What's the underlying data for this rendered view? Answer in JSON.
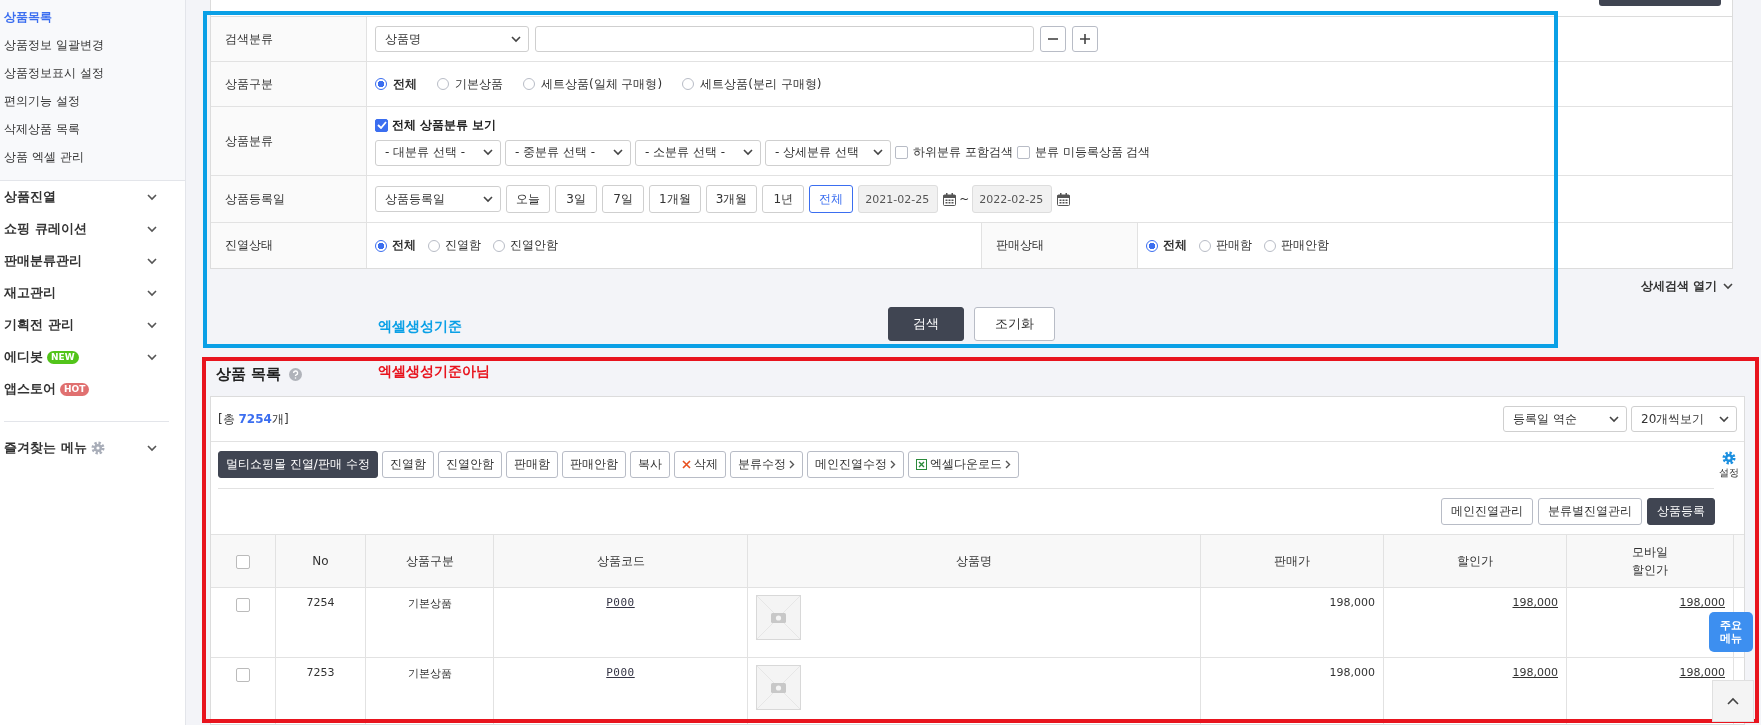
{
  "sidebar": {
    "sub_items": [
      {
        "label": "상품목록",
        "selected": true
      },
      {
        "label": "상품정보 일괄변경",
        "selected": false
      },
      {
        "label": "상품정보표시 설정",
        "selected": false
      },
      {
        "label": "편의기능 설정",
        "selected": false
      },
      {
        "label": "삭제상품 목록",
        "selected": false
      },
      {
        "label": "상품 엑셀 관리",
        "selected": false
      }
    ],
    "menus": [
      {
        "label": "상품진열",
        "expandable": true
      },
      {
        "label": "쇼핑 큐레이션",
        "expandable": true
      },
      {
        "label": "판매분류관리",
        "expandable": true
      },
      {
        "label": "재고관리",
        "expandable": true
      },
      {
        "label": "기획전 관리",
        "expandable": true
      },
      {
        "label": "에디봇",
        "expandable": true,
        "badge": {
          "text": "NEW",
          "color": "#52c41a"
        }
      },
      {
        "label": "앱스토어",
        "expandable": false,
        "badge": {
          "text": "HOT",
          "color": "#e07070"
        }
      }
    ],
    "favorites": "즐겨찾는 메뉴"
  },
  "search": {
    "rows": [
      {
        "kind": "keyword",
        "label": "검색분류",
        "select": "상품명"
      },
      {
        "kind": "radio",
        "label": "상품구분",
        "options": [
          {
            "label": "전체",
            "selected": true
          },
          {
            "label": "기본상품",
            "selected": false
          },
          {
            "label": "세트상품(일체 구매형)",
            "selected": false
          },
          {
            "label": "세트상품(분리 구매형)",
            "selected": false
          }
        ]
      },
      {
        "kind": "category",
        "label": "상품분류",
        "show_all": {
          "label": "전체 상품분류 보기",
          "checked": true
        },
        "selects": [
          "- 대분류 선택 -",
          "- 중분류 선택 -",
          "- 소분류 선택 -",
          "- 상세분류 선택"
        ],
        "checks": [
          {
            "label": "하위분류 포함검색",
            "checked": false
          },
          {
            "label": "분류 미등록상품 검색",
            "checked": false
          }
        ]
      },
      {
        "kind": "date",
        "label": "상품등록일",
        "select": "상품등록일",
        "periods": [
          {
            "label": "오늘",
            "selected": false
          },
          {
            "label": "3일",
            "selected": false
          },
          {
            "label": "7일",
            "selected": false
          },
          {
            "label": "1개월",
            "selected": false
          },
          {
            "label": "3개월",
            "selected": false
          },
          {
            "label": "1년",
            "selected": false
          },
          {
            "label": "전체",
            "selected": true
          }
        ],
        "from": "2021-02-25",
        "separator": "~",
        "to": "2022-02-25"
      },
      {
        "kind": "split",
        "cells": [
          {
            "label": "진열상태",
            "options": [
              {
                "label": "전체",
                "selected": true
              },
              {
                "label": "진열함",
                "selected": false
              },
              {
                "label": "진열안함",
                "selected": false
              }
            ]
          },
          {
            "label": "판매상태",
            "options": [
              {
                "label": "전체",
                "selected": true
              },
              {
                "label": "판매함",
                "selected": false
              },
              {
                "label": "판매안함",
                "selected": false
              }
            ]
          }
        ]
      }
    ],
    "detail_toggle": "상세검색 열기",
    "buttons": [
      {
        "label": "검색",
        "kind": "primary"
      },
      {
        "label": "조기화",
        "kind": "plain"
      }
    ]
  },
  "annotations": [
    {
      "text": "엑셀생성기준",
      "color": "#0aa0e6"
    },
    {
      "text": "엑셀생성기준아님",
      "color": "#e8141e"
    }
  ],
  "list": {
    "title": "상품 목록",
    "total_prefix": "[총 ",
    "total": "7254",
    "total_suffix": "개]",
    "sorts": [
      "등록일 역순",
      "20개씩보기"
    ],
    "actions": [
      {
        "label": "멀티쇼핑몰 진열/판매 수정",
        "kind": "primary"
      },
      {
        "label": "진열함",
        "kind": "plain"
      },
      {
        "label": "진열안함",
        "kind": "plain"
      },
      {
        "label": "판매함",
        "kind": "plain"
      },
      {
        "label": "판매안함",
        "kind": "plain"
      },
      {
        "label": "복사",
        "kind": "plain"
      },
      {
        "label": "삭제",
        "kind": "delete"
      },
      {
        "label": "분류수정",
        "kind": "menu"
      },
      {
        "label": "메인진열수정",
        "kind": "menu"
      },
      {
        "label": "엑셀다운로드",
        "kind": "excel"
      }
    ],
    "settings": "설정",
    "manage_buttons": [
      {
        "label": "메인진열관리",
        "kind": "plain"
      },
      {
        "label": "분류별진열관리",
        "kind": "plain"
      },
      {
        "label": "상품등록",
        "kind": "primary"
      }
    ],
    "table": {
      "all_checked": false,
      "columns": [
        "No",
        "상품구분",
        "상품코드",
        "상품명",
        "판매가",
        "할인가",
        "모바일 할인가"
      ],
      "rows": [
        {
          "checked": false,
          "no": "7254",
          "type": "기본상품",
          "code": "P000",
          "price": "198,000",
          "sale_price": "198,000",
          "mobile_price": "198,000"
        },
        {
          "checked": false,
          "no": "7253",
          "type": "기본상품",
          "code": "P000",
          "price": "198,000",
          "sale_price": "198,000",
          "mobile_price": "198,000"
        }
      ]
    }
  },
  "quick_menu": "주요 메뉴"
}
